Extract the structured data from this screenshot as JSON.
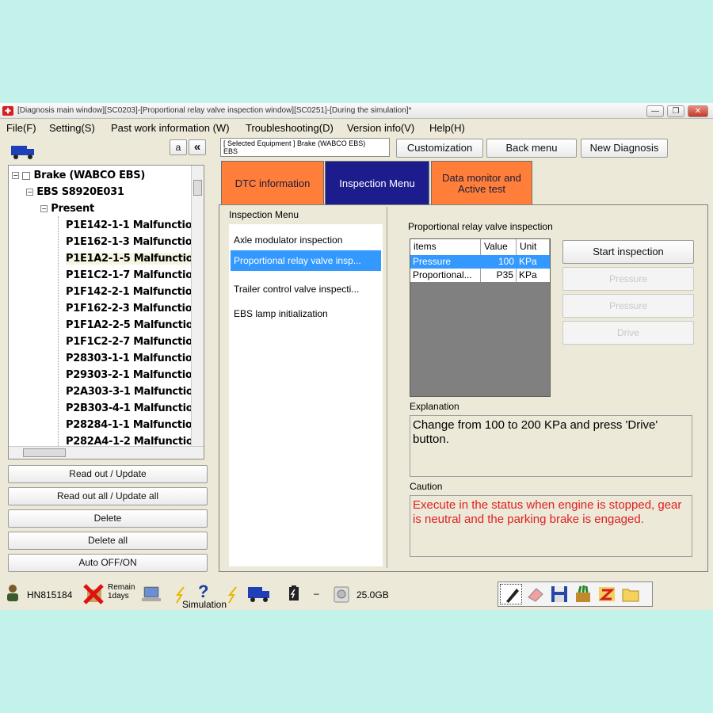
{
  "window": {
    "title": "[Diagnosis main window][SC0203]-[Proportional relay valve inspection window][SC0251]-[During the simulation]*",
    "controls": [
      "—",
      "❐",
      "✕"
    ]
  },
  "menu": [
    "File(F)",
    "Setting(S)",
    "Past work information (W)",
    "Troubleshooting(D)",
    "Version info(V)",
    "Help(H)"
  ],
  "left": {
    "small_btn": "a",
    "collapse_btn": "«",
    "tree": [
      {
        "label": "Brake (WABCO EBS)"
      },
      {
        "label": "EBS  S8920E031"
      },
      {
        "label": "Present"
      },
      {
        "label": "P1E142-1-1 Malfunctio"
      },
      {
        "label": "P1E162-1-3 Malfunctio"
      },
      {
        "label": "P1E1A2-1-5 Malfunctio"
      },
      {
        "label": "P1E1C2-1-7 Malfunctio"
      },
      {
        "label": "P1F142-2-1 Malfunctio"
      },
      {
        "label": "P1F162-2-3 Malfunctio"
      },
      {
        "label": "P1F1A2-2-5 Malfunctio"
      },
      {
        "label": "P1F1C2-2-7 Malfunctio"
      },
      {
        "label": "P28303-1-1 Malfunctio"
      },
      {
        "label": "P29303-2-1 Malfunctio"
      },
      {
        "label": "P2A303-3-1 Malfunctio"
      },
      {
        "label": "P2B303-4-1 Malfunctio"
      },
      {
        "label": "P28284-1-1 Malfunctio"
      },
      {
        "label": "P282A4-1-2 Malfunctio"
      }
    ],
    "buttons": [
      "Read out / Update",
      "Read out all / Update all",
      "Delete",
      "Delete all",
      "Auto OFF/ON"
    ]
  },
  "header": {
    "selected_equipment": "[ Selected Equipment ] Brake (WABCO EBS)",
    "selected_equipment_line2": "EBS",
    "customization": "Customization",
    "back_menu": "Back menu",
    "new_diagnosis": "New Diagnosis"
  },
  "tabs": [
    {
      "label": "DTC information",
      "color": "#ff7f3a"
    },
    {
      "label": "Inspection Menu",
      "color": "#1c1c8c"
    },
    {
      "label": "Data monitor and Active test",
      "color": "#ff7f3a"
    }
  ],
  "inspection_menu": {
    "title": "Inspection Menu",
    "items": [
      "Axle modulator inspection",
      "Proportional relay valve insp...",
      "Trailer control valve inspecti...",
      "EBS lamp initialization"
    ]
  },
  "detail": {
    "title": "Proportional relay valve inspection",
    "columns": [
      "items",
      "Value",
      "Unit"
    ],
    "rows": [
      {
        "item": "Pressure",
        "value": "100",
        "unit": "KPa"
      },
      {
        "item": "Proportional...",
        "value": "P35",
        "unit": "KPa"
      }
    ],
    "buttons": [
      "Start inspection",
      "Pressure",
      "Pressure",
      "Drive"
    ],
    "explanation_label": "Explanation",
    "explanation": "Change from 100 to 200 KPa and press 'Drive' button.",
    "caution_label": "Caution",
    "caution": "Execute in the status when engine is stopped, gear is neutral and the parking brake is engaged.",
    "caution_color": "#e02020"
  },
  "status": {
    "user": "HN815184",
    "remain": "Remain",
    "remain_days": "1days",
    "simulation": "Simulation",
    "dash": "–",
    "disk": "25.0GB"
  }
}
